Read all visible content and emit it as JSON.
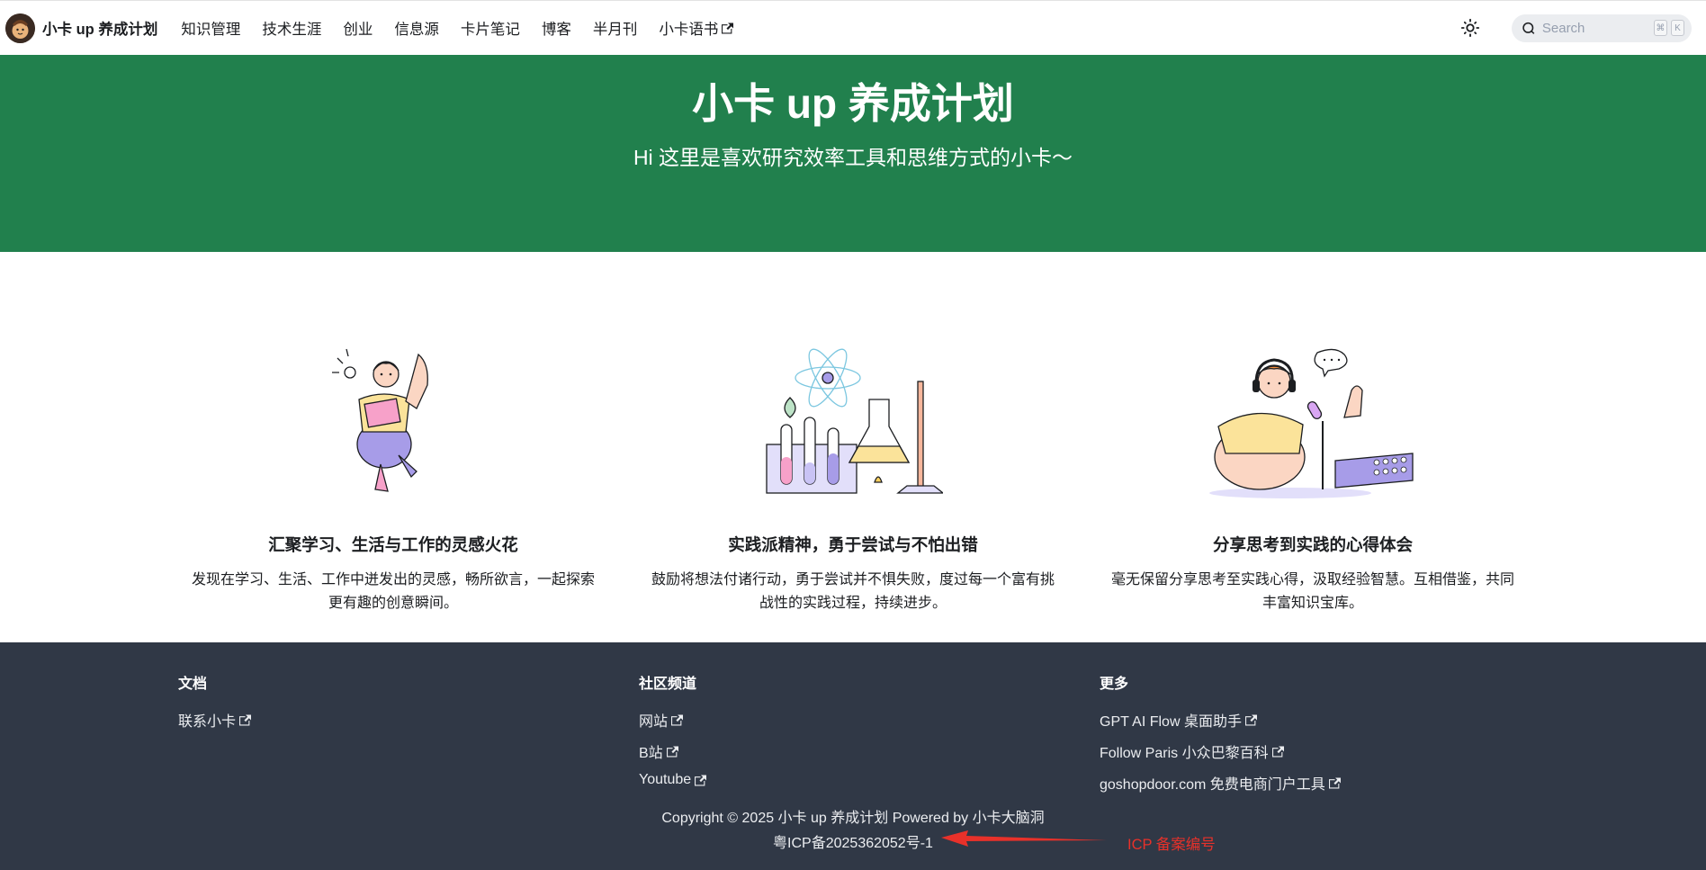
{
  "navbar": {
    "brand_title": "小卡 up 养成计划",
    "items": [
      {
        "label": "知识管理"
      },
      {
        "label": "技术生涯"
      },
      {
        "label": "创业"
      },
      {
        "label": "信息源"
      },
      {
        "label": "卡片笔记"
      },
      {
        "label": "博客"
      },
      {
        "label": "半月刊"
      },
      {
        "label": "小卡语书",
        "external": true
      }
    ],
    "search": {
      "placeholder": "Search",
      "kbd1": "⌘",
      "kbd2": "K"
    },
    "icons": {
      "theme": "sun-icon",
      "search": "search-icon",
      "external": "external-link-icon"
    }
  },
  "hero": {
    "title": "小卡 up 养成计划",
    "subtitle": "Hi 这里是喜欢研究效率工具和思维方式的小卡～",
    "background": "#21804d"
  },
  "features": [
    {
      "title": "汇聚学习、生活与工作的灵感火花",
      "desc": "发现在学习、生活、工作中迸发出的灵感，畅所欲言，一起探索更有趣的创意瞬间。"
    },
    {
      "title": "实践派精神，勇于尝试与不怕出错",
      "desc": "鼓励将想法付诸行动，勇于尝试并不惧失败，度过每一个富有挑战性的实践过程，持续进步。"
    },
    {
      "title": "分享思考到实践的心得体会",
      "desc": "毫无保留分享思考至实践心得，汲取经验智慧。互相借鉴，共同丰富知识宝库。"
    }
  ],
  "footer": {
    "background": "#303846",
    "columns": [
      {
        "title": "文档",
        "links": [
          {
            "label": "联系小卡"
          }
        ]
      },
      {
        "title": "社区频道",
        "links": [
          {
            "label": "网站"
          },
          {
            "label": "B站"
          },
          {
            "label": "Youtube"
          }
        ]
      },
      {
        "title": "更多",
        "links": [
          {
            "label": "GPT AI Flow 桌面助手"
          },
          {
            "label": "Follow Paris 小众巴黎百科"
          },
          {
            "label": "goshopdoor.com 免费电商门户工具"
          }
        ]
      }
    ],
    "copyright": "Copyright © 2025 小卡 up 养成计划 Powered by 小卡大脑洞",
    "icp": "粤ICP备2025362052号-1",
    "annotation": {
      "text": "ICP 备案编号",
      "color": "#e8312a"
    }
  }
}
